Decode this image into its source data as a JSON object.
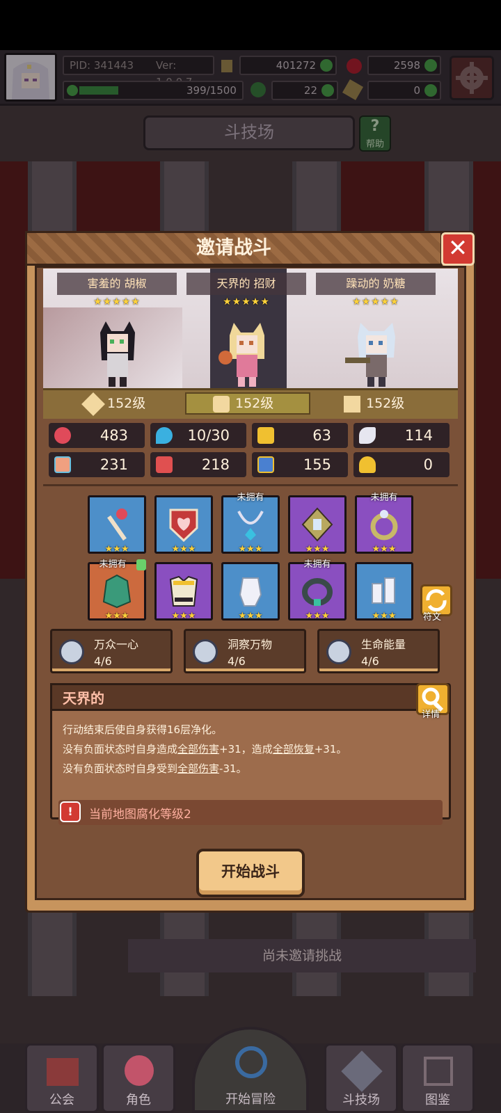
{
  "header": {
    "pid": "PID: 341443",
    "version": "Ver: 1.0.0.7",
    "gold": "401272",
    "gems": "2598",
    "stamina": "399/1500",
    "clover": "22",
    "key": "0"
  },
  "page": {
    "title": "斗技场",
    "help_label": "帮助"
  },
  "modal": {
    "title": "邀请战斗",
    "team": [
      {
        "name": "害羞的 胡椒",
        "stars": "★★★★★",
        "level": "152级"
      },
      {
        "name": "天界的 招财",
        "stars": "★★★★★",
        "level": "152级"
      },
      {
        "name": "躁动的 奶糖",
        "stars": "★★★★★",
        "level": "152级"
      }
    ],
    "stats": [
      {
        "icon": "heart-icon",
        "value": "483"
      },
      {
        "icon": "mana-drop-icon",
        "value": "10/30"
      },
      {
        "icon": "shield-icon",
        "value": "63"
      },
      {
        "icon": "wing-icon",
        "value": "114"
      },
      {
        "icon": "fist-icon",
        "value": "231"
      },
      {
        "icon": "spellbook-icon",
        "value": "218"
      },
      {
        "icon": "boot-icon",
        "value": "155"
      },
      {
        "icon": "horseshoe-icon",
        "value": "0"
      }
    ],
    "equipment_row1": [
      {
        "icon": "staff-icon",
        "stars": "★★★",
        "badge": ""
      },
      {
        "icon": "heart-shield-icon",
        "stars": "★★★",
        "badge": ""
      },
      {
        "icon": "necklace-icon",
        "stars": "★★★",
        "badge": "未拥有"
      },
      {
        "icon": "gem-amulet-icon",
        "stars": "★★★",
        "badge": ""
      },
      {
        "icon": "ring-icon",
        "stars": "★★★",
        "badge": "未拥有"
      }
    ],
    "equipment_row2": [
      {
        "icon": "crystal-armor-icon",
        "stars": "★★★",
        "badge": "未拥有"
      },
      {
        "icon": "chest-armor-icon",
        "stars": "★★★",
        "badge": ""
      },
      {
        "icon": "gauntlet-icon",
        "stars": "★★★",
        "badge": ""
      },
      {
        "icon": "collar-icon",
        "stars": "★★★",
        "badge": "未拥有"
      },
      {
        "icon": "boots-icon",
        "stars": "★★★",
        "badge": ""
      }
    ],
    "rune_label": "符文",
    "sets": [
      {
        "name": "万众一心",
        "count": "4/6"
      },
      {
        "name": "洞察万物",
        "count": "4/6"
      },
      {
        "name": "生命能量",
        "count": "4/6"
      }
    ],
    "trait": {
      "title": "天界的",
      "details_label": "详情",
      "line1": "行动结束后使自身获得16层净化。",
      "line2a": "没有负面状态时自身造成",
      "line2b": "全部伤害",
      "line2c": "+31，造成",
      "line2d": "全部恢复",
      "line2e": "+31。",
      "line3a": "没有负面状态时自身受到",
      "line3b": "全部伤害",
      "line3c": "-31。",
      "warning": "当前地图腐化等级2"
    },
    "start_button": "开始战斗"
  },
  "status": {
    "no_challenge": "尚未邀请挑战"
  },
  "nav": [
    {
      "label": "公会"
    },
    {
      "label": "角色"
    },
    {
      "label": "开始冒险"
    },
    {
      "label": "斗技场"
    },
    {
      "label": "图鉴"
    }
  ],
  "colors": {
    "close_red": "#d23a32",
    "star_gold": "#ffd23a",
    "warning_red": "#d23a32",
    "legendary_purple": "#8a4fc0",
    "rare_blue": "#4d8fc9"
  }
}
